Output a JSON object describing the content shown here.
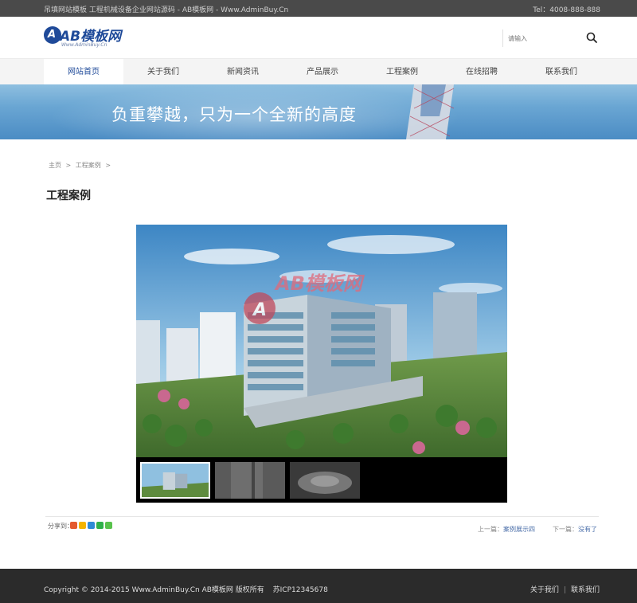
{
  "topbar": {
    "tagline": "吊填网站模板 工程机械设备企业网站源码 - AB模板网 - Www.AdminBuy.Cn",
    "phone": "Tel：4008-888-888"
  },
  "header": {
    "logo_text": "AB模板网",
    "logo_sub": "Www.AdminBuy.Cn",
    "search_placeholder": "请输入"
  },
  "nav": {
    "items": [
      {
        "label": "网站首页"
      },
      {
        "label": "关于我们"
      },
      {
        "label": "新闻资讯"
      },
      {
        "label": "产品展示"
      },
      {
        "label": "工程案例"
      },
      {
        "label": "在线招聘"
      },
      {
        "label": "联系我们"
      }
    ]
  },
  "banner": {
    "slogan": "负重攀越，只为一个全新的高度"
  },
  "breadcrumb": {
    "home": "主页",
    "sep": ">",
    "current": "工程案例",
    "sep2": ">"
  },
  "page": {
    "title": "工程案例"
  },
  "gallery": {
    "watermark": "AB模板网",
    "thumb_count": 3,
    "active_thumb": 1
  },
  "share": {
    "label": "分享到：",
    "icons": [
      "weibo-icon",
      "qzone-icon",
      "tencent-weibo-icon",
      "wechat-icon",
      "more-share-icon"
    ]
  },
  "pager": {
    "prev_label": "上一篇：",
    "prev_link": "案例展示四",
    "next_label": "下一篇：",
    "next_link": "没有了"
  },
  "footer": {
    "copyright": "Copyright © 2014-2015 Www.AdminBuy.Cn AB模板网 版权所有",
    "icp": "苏ICP12345678",
    "link_about": "关于我们",
    "link_sep": "|",
    "link_contact": "联系我们"
  },
  "colors": {
    "brand": "#1f4a99",
    "topbar": "#4a4a4a",
    "footer": "#2b2b2b",
    "link": "#4a6ea9"
  }
}
